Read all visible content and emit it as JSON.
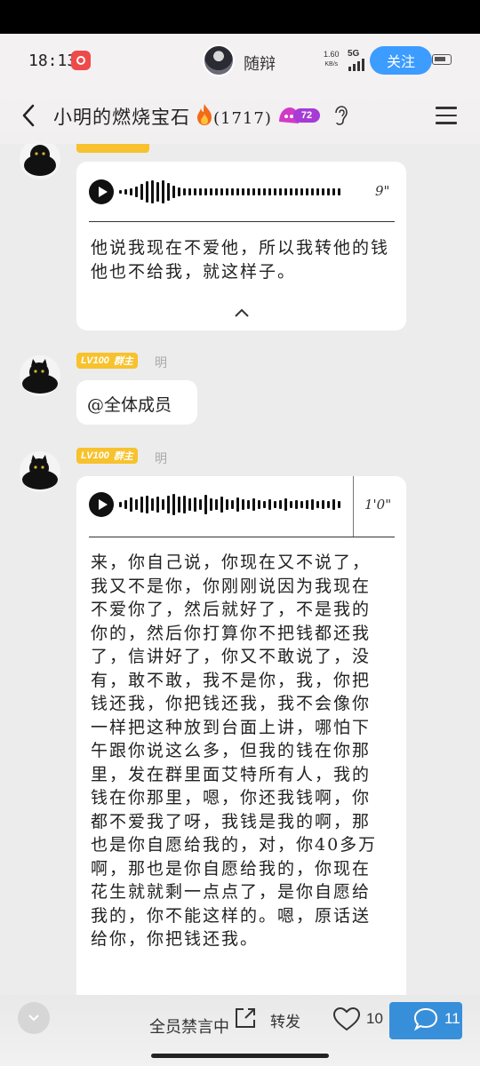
{
  "status": {
    "time": "18:13",
    "streamer_name": "随辩",
    "net_speed_value": "1.60",
    "net_speed_unit": "KB/s",
    "net_type": "5G",
    "follow_label": "关注"
  },
  "nav": {
    "group_name": "小明的燃烧宝石",
    "member_count": "(1717)",
    "level": "72"
  },
  "messages": [
    {
      "type": "voice",
      "duration": "9\"",
      "transcript": "他说我现在不爱他，所以我转他的钱他也不给我，就这样子。"
    },
    {
      "type": "text",
      "badge_level": "LV100",
      "badge_role": "群主",
      "sender": "明",
      "text": "@全体成员"
    },
    {
      "type": "voice",
      "badge_level": "LV100",
      "badge_role": "群主",
      "sender": "明",
      "duration": "1'0\"",
      "transcript": "来，你自己说，你现在又不说了，我又不是你，你刚刚说因为我现在不爱你了，然后就好了，不是我的你的，然后你打算你不把钱都还我了，信讲好了，你又不敢说了，没有，敢不敢，我不是你，我，你把钱还我，你把钱还我，我不会像你一样把这种放到台面上讲，哪怕下午跟你说这么多，但我的钱在你那里，发在群里面艾特所有人，我的钱在你那里，嗯，你还我钱啊，你都不爱我了呀，我钱是我的啊，那也是你自愿给我的，对，你40多万啊，那也是你自愿给我的，你现在花生就就剩一点点了，是你自愿给我的，你不能这样的。嗯，原话送给你，你把钱还我。"
    }
  ],
  "bottom": {
    "mute_text": "全员禁言中",
    "share_label": "转发",
    "like_count": "10",
    "comment_count": "11"
  }
}
